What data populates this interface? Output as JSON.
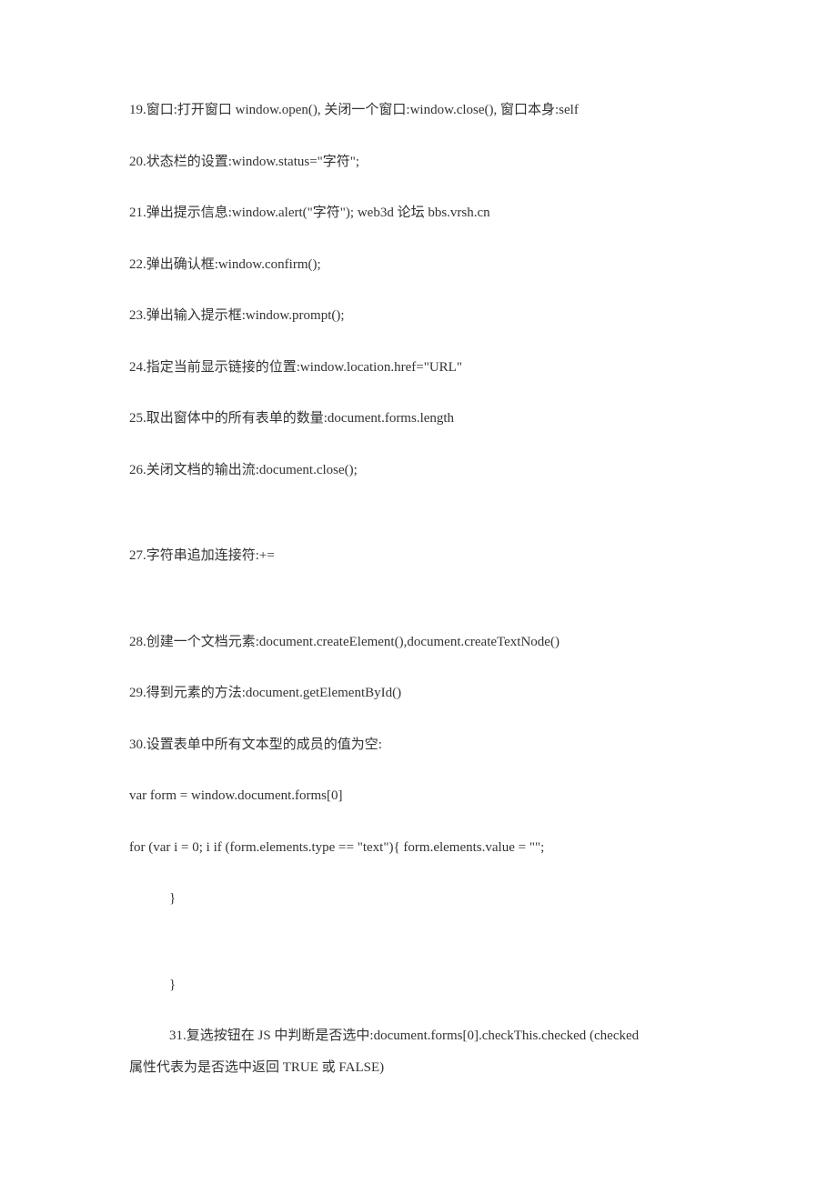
{
  "lines": {
    "l19": "19.窗口:打开窗口 window.open(), 关闭一个窗口:window.close(), 窗口本身:self",
    "l20": "20.状态栏的设置:window.status=\"字符\";",
    "l21": "21.弹出提示信息:window.alert(\"字符\"); web3d 论坛 bbs.vrsh.cn",
    "l22": "22.弹出确认框:window.confirm();",
    "l23": "23.弹出输入提示框:window.prompt();",
    "l24": "24.指定当前显示链接的位置:window.location.href=\"URL\"",
    "l25": "25.取出窗体中的所有表单的数量:document.forms.length",
    "l26": "26.关闭文档的输出流:document.close();",
    "l27": "27.字符串追加连接符:+=",
    "l28": "28.创建一个文档元素:document.createElement(),document.createTextNode()",
    "l29": "29.得到元素的方法:document.getElementById()",
    "l30": "30.设置表单中所有文本型的成员的值为空:",
    "l30a": "var form = window.document.forms[0]",
    "l30b": "for (var i = 0; i if (form.elements.type == \"text\"){ form.elements.value = \"\";",
    "l30c": "}",
    "l30d": "}",
    "l31a": "31.复选按钮在 JS 中判断是否选中:document.forms[0].checkThis.checked (checked",
    "l31b": "属性代表为是否选中返回 TRUE 或 FALSE)"
  }
}
